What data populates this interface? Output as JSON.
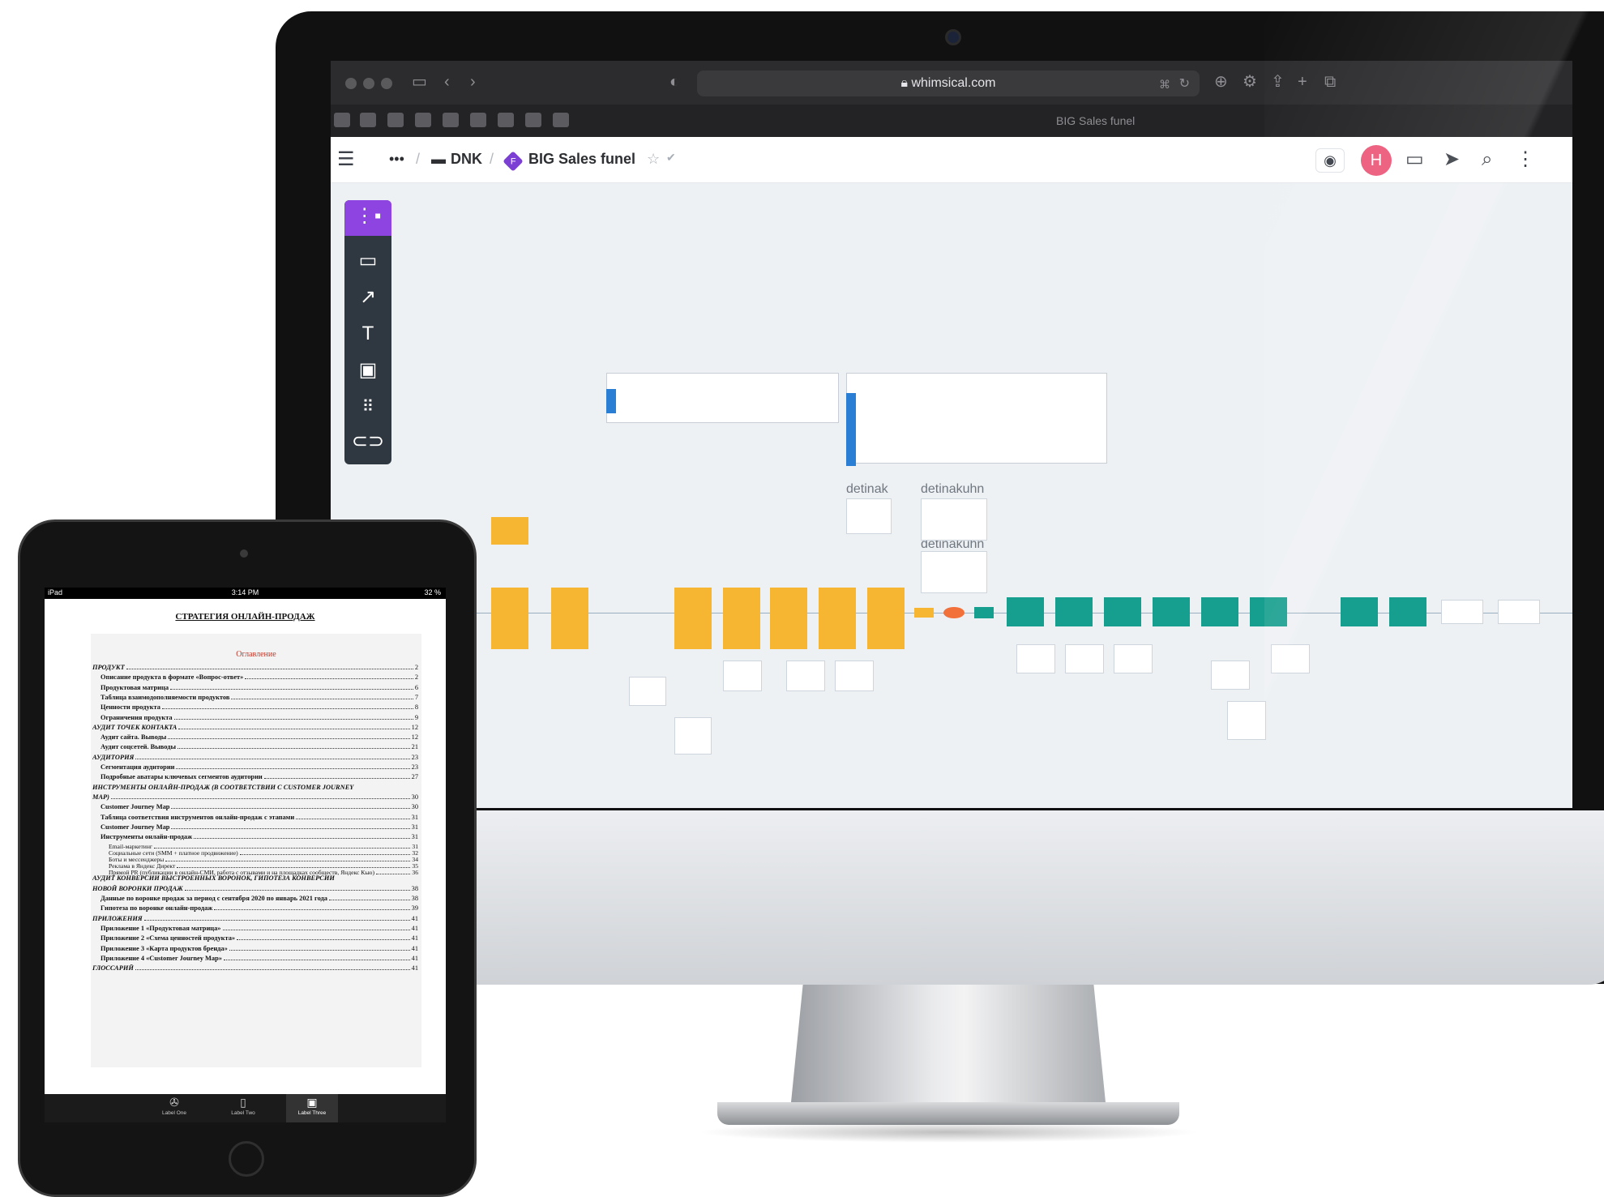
{
  "browser": {
    "url": "whimsical.com",
    "tab_title": "BIG Sales funel"
  },
  "app": {
    "breadcrumb_more": "•••",
    "folder": "DNK",
    "board_badge": "F",
    "board_title": "BIG Sales funel",
    "avatar_initial": "H"
  },
  "canvas": {
    "label_1": "detinak",
    "label_2": "detinakuhn",
    "label_3": "detinakuhn"
  },
  "ipad": {
    "status_device": "iPad",
    "status_time": "3:14 PM",
    "status_battery": "32 %",
    "doc_title": "СТРАТЕГИЯ ОНЛАЙН-ПРОДАЖ",
    "toc_heading": "Оглавление",
    "toc": [
      {
        "t": "ПРОДУКТ",
        "p": "2",
        "lvl": 1
      },
      {
        "t": "Описание продукта в формате «Вопрос-ответ»",
        "p": "2",
        "lvl": 2
      },
      {
        "t": "Продуктовая матрица",
        "p": "6",
        "lvl": 2
      },
      {
        "t": "Таблица взаимодополняемости продуктов",
        "p": "7",
        "lvl": 2
      },
      {
        "t": "Ценности продукта",
        "p": "8",
        "lvl": 2
      },
      {
        "t": "Ограничения продукта",
        "p": "9",
        "lvl": 2
      },
      {
        "t": "АУДИТ ТОЧЕК КОНТАКТА",
        "p": "12",
        "lvl": 1
      },
      {
        "t": "Аудит сайта. Выводы",
        "p": "12",
        "lvl": 2
      },
      {
        "t": "Аудит соцсетей. Выводы",
        "p": "21",
        "lvl": 2
      },
      {
        "t": "АУДИТОРИЯ",
        "p": "23",
        "lvl": 1
      },
      {
        "t": "Сегментация аудитории",
        "p": "23",
        "lvl": 2
      },
      {
        "t": "Подробные аватары ключевых сегментов аудитории",
        "p": "27",
        "lvl": 2
      },
      {
        "t": "ИНСТРУМЕНТЫ ОНЛАЙН-ПРОДАЖ (В СООТВЕТСТВИИ С CUSTOMER JOURNEY",
        "p": "",
        "lvl": 1
      },
      {
        "t": "MAP)",
        "p": "30",
        "lvl": 1
      },
      {
        "t": "Customer Journey Map",
        "p": "30",
        "lvl": 2
      },
      {
        "t": "Таблица соответствия инструментов онлайн-продаж с этапами",
        "p": "31",
        "lvl": 2
      },
      {
        "t": "Customer Journey Map",
        "p": "31",
        "lvl": 2
      },
      {
        "t": "Инструменты онлайн-продаж",
        "p": "31",
        "lvl": 2
      },
      {
        "t": "Email-маркетинг",
        "p": "31",
        "lvl": 3
      },
      {
        "t": "Социальные сети (SMM + платное продвижение)",
        "p": "32",
        "lvl": 3
      },
      {
        "t": "Боты и мессенджеры",
        "p": "34",
        "lvl": 3
      },
      {
        "t": "Реклама в Яндекс Директ",
        "p": "35",
        "lvl": 3
      },
      {
        "t": "Прямой PR (публикации в онлайн-СМИ, работа с отзывами и на площадках сообществ, Яндекс Кью)",
        "p": "36",
        "lvl": 3
      },
      {
        "t": "АУДИТ КОНВЕРСИИ ВЫСТРОЕННЫХ ВОРОНОК, ГИПОТЕЗА КОНВЕРСИИ",
        "p": "",
        "lvl": 1
      },
      {
        "t": "НОВОЙ ВОРОНКИ ПРОДАЖ",
        "p": "38",
        "lvl": 1
      },
      {
        "t": "Данные по воронке продаж за период с сентября 2020 по январь 2021 года",
        "p": "38",
        "lvl": 2
      },
      {
        "t": "Гипотеза по воронке онлайн-продаж",
        "p": "39",
        "lvl": 2
      },
      {
        "t": "ПРИЛОЖЕНИЯ",
        "p": "41",
        "lvl": 1
      },
      {
        "t": "Приложение 1 «Продуктовая матрица»",
        "p": "41",
        "lvl": 2
      },
      {
        "t": "Приложение 2 «Схема ценностей продукта»",
        "p": "41",
        "lvl": 2
      },
      {
        "t": "Приложение 3 «Карта продуктов бренда»",
        "p": "41",
        "lvl": 2
      },
      {
        "t": "Приложение 4 «Customer Journey Map»",
        "p": "41",
        "lvl": 2
      },
      {
        "t": "ГЛОССАРИЙ",
        "p": "41",
        "lvl": 1
      }
    ],
    "tabs": [
      {
        "label": "Label One",
        "icon": "gamepad-icon"
      },
      {
        "label": "Label Two",
        "icon": "ipod-icon"
      },
      {
        "label": "Label Three",
        "icon": "monitor-icon"
      }
    ]
  },
  "colors": {
    "accent_purple": "#8e44e0",
    "avatar_pink": "#ec5a7a",
    "sticky_yellow": "#f7b631",
    "sticky_teal": "#169e8e",
    "toc_heading_red": "#c0392b"
  }
}
